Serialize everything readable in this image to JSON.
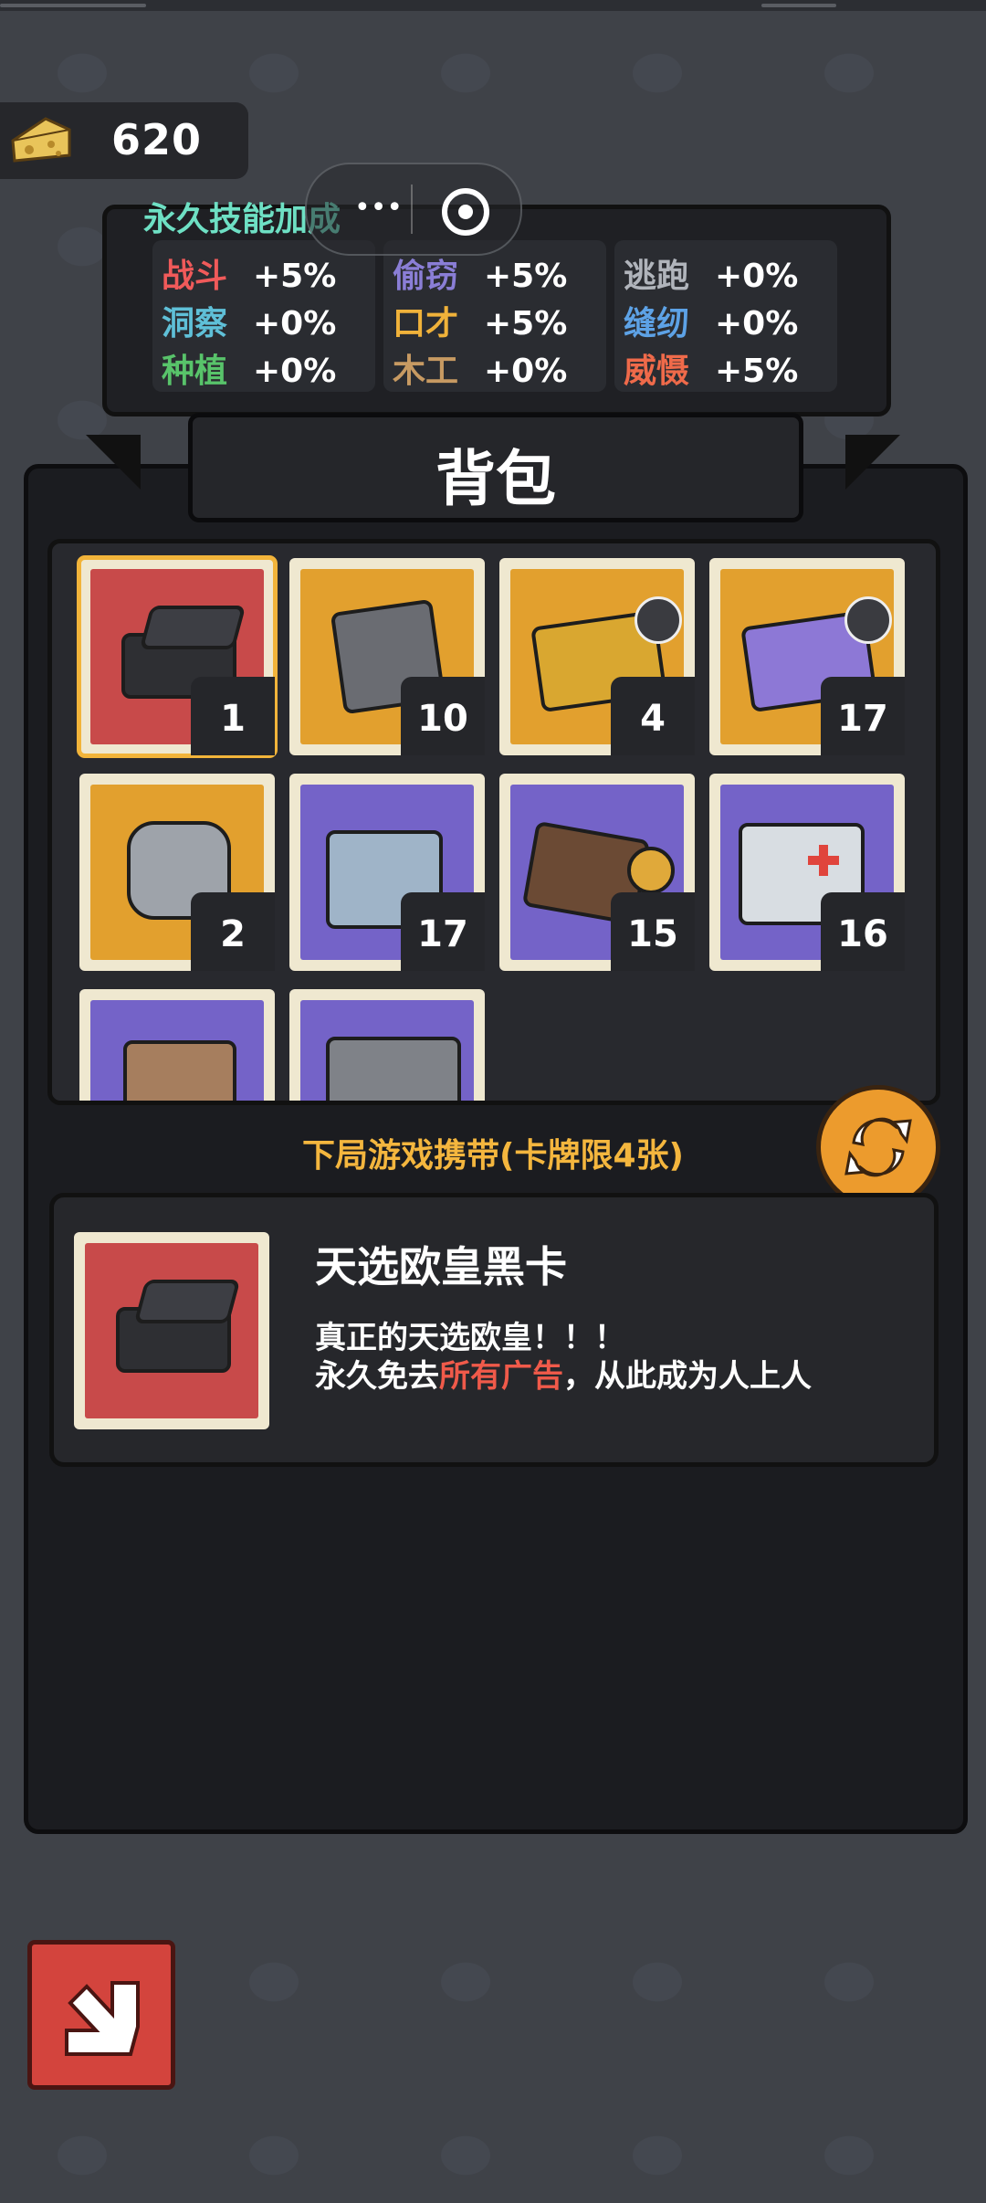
{
  "currency": {
    "value": "620",
    "icon": "cheese-icon"
  },
  "skills": {
    "title": "永久技能加成",
    "columns": [
      {
        "rows": [
          {
            "name": "战斗",
            "value": "+5%",
            "color": "#f05a5a"
          },
          {
            "name": "洞察",
            "value": "+0%",
            "color": "#5fc0d8"
          },
          {
            "name": "种植",
            "value": "+0%",
            "color": "#58c36a"
          }
        ]
      },
      {
        "rows": [
          {
            "name": "偷窃",
            "value": "+5%",
            "color": "#8a7ed6"
          },
          {
            "name": "口才",
            "value": "+5%",
            "color": "#f0b23a"
          },
          {
            "name": "木工",
            "value": "+0%",
            "color": "#c79a62"
          }
        ]
      },
      {
        "rows": [
          {
            "name": "逃跑",
            "value": "+0%",
            "color": "#b0b4bb"
          },
          {
            "name": "缝纫",
            "value": "+0%",
            "color": "#5da2e6"
          },
          {
            "name": "威慑",
            "value": "+5%",
            "color": "#ef6a4a"
          }
        ]
      }
    ]
  },
  "backpack": {
    "title": "背包",
    "items": [
      {
        "name": "lucky-black-card",
        "count": "1",
        "bg": "#c84a4a",
        "selected": true
      },
      {
        "name": "gray-box",
        "count": "10",
        "bg": "#e2a02e"
      },
      {
        "name": "gold-card-pack",
        "count": "4",
        "bg": "#e2a02e",
        "badge": true
      },
      {
        "name": "purple-card-pack",
        "count": "17",
        "bg": "#e2a02e",
        "badge": true
      },
      {
        "name": "silver-mouse-token",
        "count": "2",
        "bg": "#e2a02e"
      },
      {
        "name": "cash-bag",
        "count": "17",
        "bg": "#7463c8"
      },
      {
        "name": "wallet-coins",
        "count": "15",
        "bg": "#7463c8"
      },
      {
        "name": "first-aid-kit",
        "count": "16",
        "bg": "#7463c8"
      },
      {
        "name": "paper-bag",
        "count": "",
        "bg": "#7463c8"
      },
      {
        "name": "metal-case",
        "count": "",
        "bg": "#7463c8"
      }
    ]
  },
  "carry_label": "下局游戏携带(卡牌限4张)",
  "detail": {
    "name": "天选欧皇黑卡",
    "line1": "真正的天选欧皇！！！",
    "line2_pre": "永久免去",
    "line2_highlight": "所有广告",
    "line2_post": "，从此成为人上人"
  },
  "capsule": {
    "menu_icon": "more-dots-icon",
    "close_icon": "target-icon"
  }
}
